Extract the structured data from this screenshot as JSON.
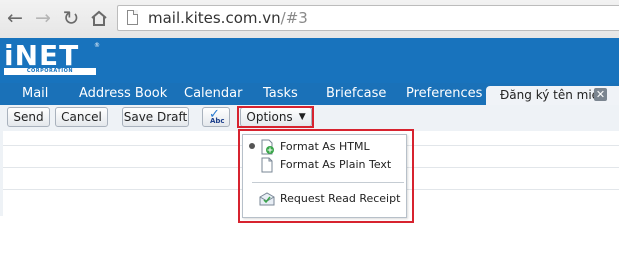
{
  "browser": {
    "url_host": "mail.kites.com.vn",
    "url_path": "/#3"
  },
  "logo": {
    "text": "iNET",
    "registered": "®",
    "subtitle": "CORPORATION"
  },
  "tabs": [
    {
      "label": "Mail"
    },
    {
      "label": "Address Book"
    },
    {
      "label": "Calendar"
    },
    {
      "label": "Tasks"
    },
    {
      "label": "Briefcase"
    },
    {
      "label": "Preferences"
    }
  ],
  "active_tab": {
    "label": "Đăng ký tên miề",
    "close": "✕"
  },
  "toolbar": {
    "send": "Send",
    "cancel": "Cancel",
    "save_draft": "Save Draft",
    "options": "Options",
    "options_caret": "▼"
  },
  "options_menu": {
    "items": [
      {
        "label": "Format As HTML",
        "selected": true,
        "icon": "html-format-icon"
      },
      {
        "label": "Format As Plain Text",
        "selected": false,
        "icon": "plain-text-icon"
      },
      {
        "label": "Request Read Receipt",
        "icon": "read-receipt-icon"
      }
    ]
  },
  "colors": {
    "header_blue": "#1873bd",
    "highlight_red": "#d7232f"
  }
}
